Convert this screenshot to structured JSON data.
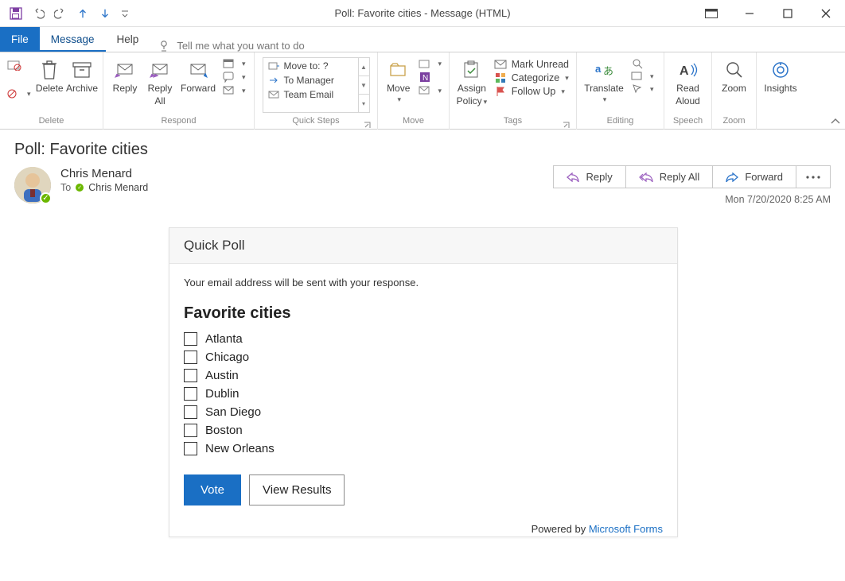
{
  "window": {
    "title": "Poll: Favorite cities  -  Message (HTML)"
  },
  "tabs": {
    "file": "File",
    "message": "Message",
    "help": "Help",
    "tellme": "Tell me what you want to do"
  },
  "ribbon": {
    "delete": {
      "label": "Delete",
      "archive": "Archive",
      "group": "Delete"
    },
    "respond": {
      "reply": "Reply",
      "replyall_l1": "Reply",
      "replyall_l2": "All",
      "forward": "Forward",
      "group": "Respond"
    },
    "quicksteps": {
      "moveto": "Move to: ?",
      "tomanager": "To Manager",
      "teamemail": "Team Email",
      "group": "Quick Steps"
    },
    "move": {
      "move": "Move",
      "group": "Move"
    },
    "tags": {
      "assign_l1": "Assign",
      "assign_l2": "Policy",
      "unread": "Mark Unread",
      "categorize": "Categorize",
      "followup": "Follow Up",
      "group": "Tags"
    },
    "editing": {
      "translate": "Translate",
      "group": "Editing"
    },
    "speech": {
      "read_l1": "Read",
      "read_l2": "Aloud",
      "group": "Speech"
    },
    "zoom": {
      "zoom": "Zoom",
      "group": "Zoom"
    },
    "insights": {
      "insights": "Insights"
    }
  },
  "message": {
    "subject": "Poll: Favorite cities",
    "sender": "Chris Menard",
    "to_label": "To",
    "to_value": "Chris Menard",
    "date": "Mon 7/20/2020 8:25 AM"
  },
  "actions": {
    "reply": "Reply",
    "replyall": "Reply All",
    "forward": "Forward"
  },
  "poll": {
    "header": "Quick Poll",
    "note": "Your email address will be sent with your response.",
    "question": "Favorite cities",
    "options": [
      "Atlanta",
      "Chicago",
      "Austin",
      "Dublin",
      "San Diego",
      "Boston",
      "New Orleans"
    ],
    "vote": "Vote",
    "view": "View Results",
    "footer_prefix": "Powered by ",
    "footer_link": "Microsoft Forms"
  }
}
